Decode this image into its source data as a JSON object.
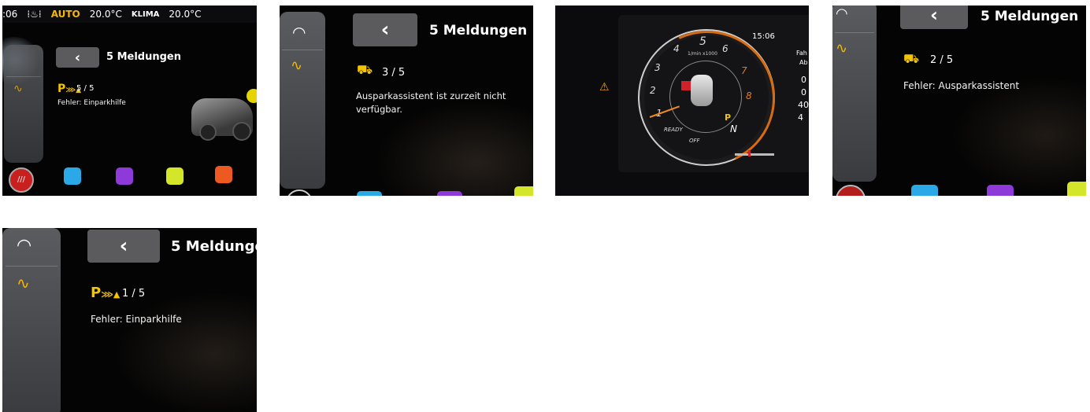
{
  "photo1": {
    "status": {
      "time": ":06",
      "auto": "AUTO",
      "temp_left": "20.0°C",
      "klima": "KLIMA",
      "temp_right": "20.0°C"
    },
    "back_glyph": "‹",
    "title": "5 Meldungen",
    "p_symbol": "P",
    "count": "5 / 5",
    "message": "Fehler: Einparkhilfe"
  },
  "photo2": {
    "back_glyph": "‹",
    "title": "5 Meldungen",
    "count": "3 / 5",
    "message_line1": "Ausparkassistent ist zurzeit nicht",
    "message_line2": "verfügbar."
  },
  "photo3": {
    "time": "15:06",
    "rpm_unit": "1/min x1000",
    "ticks": [
      "1",
      "2",
      "3",
      "4",
      "5",
      "6",
      "7",
      "8"
    ],
    "ready": "READY",
    "off": "OFF",
    "gear": "N",
    "p_symbol": "P",
    "right_labels": [
      "Fah",
      "Ab"
    ],
    "right_values": [
      "0",
      "0",
      "40",
      "4"
    ]
  },
  "photo4": {
    "back_glyph": "‹",
    "title": "5 Meldungen",
    "count": "2 / 5",
    "message": "Fehler: Ausparkassistent"
  },
  "photo5": {
    "back_glyph": "‹",
    "title": "5 Meldunge",
    "p_symbol": "P",
    "count": "1 / 5",
    "message": "Fehler: Einparkhilfe"
  }
}
